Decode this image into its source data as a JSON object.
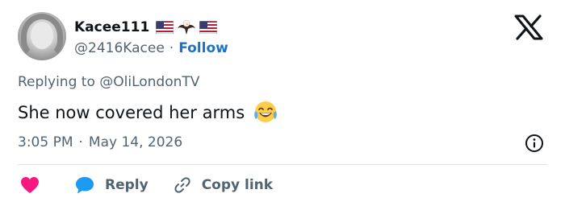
{
  "author": {
    "display_name": "Kacee111",
    "handle": "@2416Kacee",
    "separator": "·",
    "follow_label": "Follow",
    "name_badges": [
      "us-flag-emoji",
      "eagle-emoji",
      "us-flag-emoji"
    ]
  },
  "brand": {
    "logo_icon": "x-logo-icon"
  },
  "tweet": {
    "replying_to": "Replying to @OliLondonTV",
    "text": "She now covered her arms",
    "emoji_icon": "face-with-tears-of-joy-emoji",
    "time": "3:05 PM",
    "date": "May 14, 2026",
    "separator": "·"
  },
  "actions": {
    "like_icon": "heart-icon",
    "like_color": "#f91880",
    "reply_label": "Reply",
    "reply_icon": "speech-bubble-icon",
    "reply_color": "#1d9bf0",
    "copy_label": "Copy link",
    "copy_icon": "link-icon"
  },
  "colors": {
    "text_primary": "#0f1419",
    "text_secondary": "#536471",
    "link": "#1d72c7",
    "divider": "#dfe3e6"
  }
}
